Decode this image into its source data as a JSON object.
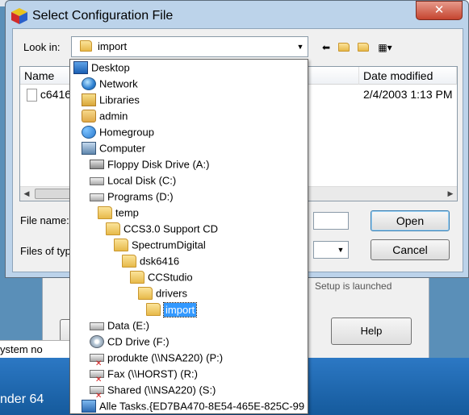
{
  "background": {
    "status_text": "ystem no",
    "taskbar_label": "nder 64",
    "parent_button_help": "Help",
    "parent_partial_text": "Setup is launched"
  },
  "dialog": {
    "title": "Select Configuration File",
    "close_symbol": "✕",
    "look_in_label": "Look in:",
    "look_in_value": "import",
    "toolbar": {
      "back_icon": "back-arrow-icon",
      "up_icon": "folder-up-icon",
      "new_folder_icon": "new-folder-icon",
      "view_icon": "view-menu-icon"
    },
    "columns": {
      "name": "Name",
      "date_modified": "Date modified"
    },
    "files": [
      {
        "name": "c6416",
        "date_modified": "2/4/2003 1:13 PM"
      }
    ],
    "file_name_label": "File name:",
    "file_name_value": "",
    "files_of_type_label": "Files of typ",
    "files_of_type_value": "",
    "open_button": "Open",
    "cancel_button": "Cancel"
  },
  "dropdown_items": [
    {
      "label": "Desktop",
      "icon": "desktop-icon",
      "level": 0
    },
    {
      "label": "Network",
      "icon": "network-icon",
      "level": 1
    },
    {
      "label": "Libraries",
      "icon": "libraries-icon",
      "level": 1
    },
    {
      "label": "admin",
      "icon": "user-folder-icon",
      "level": 1
    },
    {
      "label": "Homegroup",
      "icon": "homegroup-icon",
      "level": 1
    },
    {
      "label": "Computer",
      "icon": "computer-icon",
      "level": 1
    },
    {
      "label": "Floppy Disk Drive (A:)",
      "icon": "floppy-drive-icon",
      "level": 2
    },
    {
      "label": "Local Disk (C:)",
      "icon": "hard-drive-icon",
      "level": 2
    },
    {
      "label": "Programs (D:)",
      "icon": "hard-drive-icon",
      "level": 2
    },
    {
      "label": "temp",
      "icon": "folder-icon",
      "level": 3
    },
    {
      "label": "CCS3.0 Support CD",
      "icon": "folder-icon",
      "level": 4
    },
    {
      "label": "SpectrumDigital",
      "icon": "folder-icon",
      "level": 5
    },
    {
      "label": "dsk6416",
      "icon": "folder-icon",
      "level": 6
    },
    {
      "label": "CCStudio",
      "icon": "folder-icon",
      "level": 7
    },
    {
      "label": "drivers",
      "icon": "folder-icon",
      "level": 8
    },
    {
      "label": "import",
      "icon": "open-folder-icon",
      "level": 9,
      "selected": true
    },
    {
      "label": "Data (E:)",
      "icon": "hard-drive-icon",
      "level": 2
    },
    {
      "label": "CD Drive (F:)",
      "icon": "cd-drive-icon",
      "level": 2
    },
    {
      "label": "produkte (\\\\NSA220) (P:)",
      "icon": "network-drive-disconnected-icon",
      "level": 2
    },
    {
      "label": "Fax (\\\\HORST) (R:)",
      "icon": "network-drive-disconnected-icon",
      "level": 2
    },
    {
      "label": "Shared (\\\\NSA220) (S:)",
      "icon": "network-drive-disconnected-icon",
      "level": 2
    },
    {
      "label": "Alle Tasks.{ED7BA470-8E54-465E-825C-99",
      "icon": "all-tasks-icon",
      "level": 1
    }
  ]
}
